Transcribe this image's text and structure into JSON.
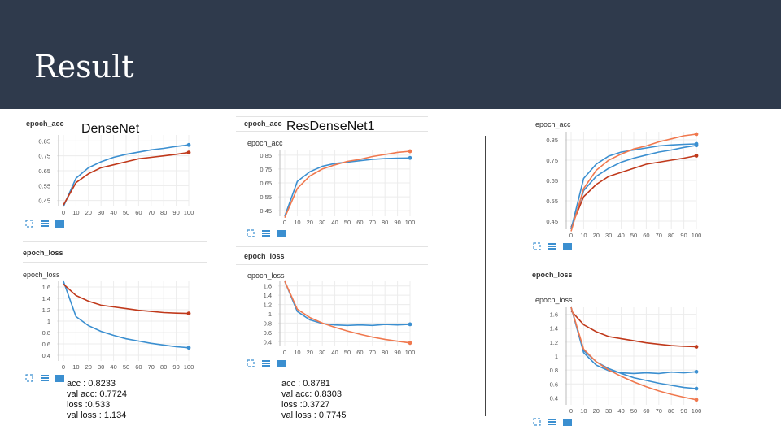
{
  "slide": {
    "title": "Result"
  },
  "colors": {
    "header_bg": "#2f3a4c",
    "train": "#3b8fd0",
    "val": "#c0391b",
    "orange": "#f0784e"
  },
  "panels": [
    {
      "name": "DenseNet",
      "acc_title": "epoch_acc",
      "loss_title": "epoch_loss",
      "stats": [
        "acc : 0.8233",
        "val acc: 0.7724",
        "loss :0.533",
        "val loss : 1.134"
      ]
    },
    {
      "name": "ResDenseNet1",
      "acc_title": "epoch_acc",
      "loss_title": "epoch_loss",
      "stats": [
        "acc : 0.8781",
        "val acc: 0.8303",
        "loss :0.3727",
        "val loss : 0.7745"
      ]
    },
    {
      "name": "",
      "acc_title": "epoch_acc",
      "loss_title": "epoch_loss",
      "stats": []
    }
  ],
  "chart_data": [
    {
      "type": "line",
      "title": "epoch_acc",
      "panel": "DenseNet",
      "x": [
        0,
        10,
        20,
        30,
        40,
        50,
        60,
        70,
        80,
        90,
        100
      ],
      "xticks": [
        "0",
        "10",
        "20",
        "30",
        "40",
        "50",
        "60",
        "70",
        "80",
        "90",
        "100"
      ],
      "yticks": [
        "0.45",
        "0.55",
        "0.65",
        "0.75",
        "0.85"
      ],
      "ylim": [
        0.41,
        0.89
      ],
      "series": [
        {
          "color": "#3b8fd0",
          "values": [
            0.41,
            0.6,
            0.67,
            0.71,
            0.74,
            0.76,
            0.775,
            0.79,
            0.8,
            0.813,
            0.823
          ]
        },
        {
          "color": "#c0391b",
          "values": [
            0.42,
            0.57,
            0.63,
            0.67,
            0.69,
            0.71,
            0.73,
            0.74,
            0.75,
            0.76,
            0.772
          ]
        }
      ]
    },
    {
      "type": "line",
      "title": "epoch_loss",
      "panel": "DenseNet",
      "x": [
        0,
        10,
        20,
        30,
        40,
        50,
        60,
        70,
        80,
        90,
        100
      ],
      "xticks": [
        "0",
        "10",
        "20",
        "30",
        "40",
        "50",
        "60",
        "70",
        "80",
        "90",
        "100"
      ],
      "yticks": [
        "0.4",
        "0.6",
        "0.8",
        "1",
        "1.2",
        "1.4",
        "1.6"
      ],
      "ylim": [
        0.3,
        1.7
      ],
      "series": [
        {
          "color": "#3b8fd0",
          "values": [
            1.7,
            1.08,
            0.92,
            0.82,
            0.75,
            0.69,
            0.65,
            0.61,
            0.58,
            0.55,
            0.533
          ]
        },
        {
          "color": "#c0391b",
          "values": [
            1.65,
            1.45,
            1.35,
            1.28,
            1.25,
            1.22,
            1.19,
            1.17,
            1.15,
            1.14,
            1.134
          ]
        }
      ]
    },
    {
      "type": "line",
      "title": "epoch_acc",
      "panel": "ResDenseNet1",
      "x": [
        0,
        10,
        20,
        30,
        40,
        50,
        60,
        70,
        80,
        90,
        100
      ],
      "xticks": [
        "0",
        "10",
        "20",
        "30",
        "40",
        "50",
        "60",
        "70",
        "80",
        "90",
        "100"
      ],
      "yticks": [
        "0.45",
        "0.55",
        "0.65",
        "0.75",
        "0.85"
      ],
      "ylim": [
        0.41,
        0.89
      ],
      "series": [
        {
          "color": "#3b8fd0",
          "values": [
            0.41,
            0.66,
            0.73,
            0.77,
            0.79,
            0.8,
            0.81,
            0.82,
            0.825,
            0.828,
            0.83
          ]
        },
        {
          "color": "#f0784e",
          "values": [
            0.4,
            0.61,
            0.7,
            0.75,
            0.78,
            0.805,
            0.82,
            0.84,
            0.855,
            0.87,
            0.878
          ]
        }
      ]
    },
    {
      "type": "line",
      "title": "epoch_loss",
      "panel": "ResDenseNet1",
      "x": [
        0,
        10,
        20,
        30,
        40,
        50,
        60,
        70,
        80,
        90,
        100
      ],
      "xticks": [
        "0",
        "10",
        "20",
        "30",
        "40",
        "50",
        "60",
        "70",
        "80",
        "90",
        "100"
      ],
      "yticks": [
        "0.4",
        "0.6",
        "0.8",
        "1",
        "1.2",
        "1.4",
        "1.6"
      ],
      "ylim": [
        0.3,
        1.7
      ],
      "series": [
        {
          "color": "#3b8fd0",
          "values": [
            1.7,
            1.05,
            0.87,
            0.79,
            0.76,
            0.75,
            0.76,
            0.75,
            0.77,
            0.76,
            0.7745
          ]
        },
        {
          "color": "#f0784e",
          "values": [
            1.7,
            1.1,
            0.92,
            0.8,
            0.71,
            0.63,
            0.56,
            0.5,
            0.45,
            0.41,
            0.3727
          ]
        }
      ]
    },
    {
      "type": "line",
      "title": "epoch_acc",
      "panel": "combined",
      "x": [
        0,
        10,
        20,
        30,
        40,
        50,
        60,
        70,
        80,
        90,
        100
      ],
      "xticks": [
        "0",
        "10",
        "20",
        "30",
        "40",
        "50",
        "60",
        "70",
        "80",
        "90",
        "100"
      ],
      "yticks": [
        "0.45",
        "0.55",
        "0.65",
        "0.75",
        "0.85"
      ],
      "ylim": [
        0.41,
        0.89
      ],
      "series": [
        {
          "color": "#3b8fd0",
          "values": [
            0.41,
            0.6,
            0.67,
            0.71,
            0.74,
            0.76,
            0.775,
            0.79,
            0.8,
            0.813,
            0.823
          ]
        },
        {
          "color": "#c0391b",
          "values": [
            0.42,
            0.57,
            0.63,
            0.67,
            0.69,
            0.71,
            0.73,
            0.74,
            0.75,
            0.76,
            0.772
          ]
        },
        {
          "color": "#3b8fd0",
          "values": [
            0.41,
            0.66,
            0.73,
            0.77,
            0.79,
            0.8,
            0.81,
            0.82,
            0.825,
            0.828,
            0.83
          ]
        },
        {
          "color": "#f0784e",
          "values": [
            0.4,
            0.61,
            0.7,
            0.75,
            0.78,
            0.805,
            0.82,
            0.84,
            0.855,
            0.87,
            0.878
          ]
        }
      ]
    },
    {
      "type": "line",
      "title": "epoch_loss",
      "panel": "combined",
      "x": [
        0,
        10,
        20,
        30,
        40,
        50,
        60,
        70,
        80,
        90,
        100
      ],
      "xticks": [
        "0",
        "10",
        "20",
        "30",
        "40",
        "50",
        "60",
        "70",
        "80",
        "90",
        "100"
      ],
      "yticks": [
        "0.4",
        "0.6",
        "0.8",
        "1",
        "1.2",
        "1.4",
        "1.6"
      ],
      "ylim": [
        0.3,
        1.7
      ],
      "series": [
        {
          "color": "#3b8fd0",
          "values": [
            1.7,
            1.08,
            0.92,
            0.82,
            0.75,
            0.69,
            0.65,
            0.61,
            0.58,
            0.55,
            0.533
          ]
        },
        {
          "color": "#c0391b",
          "values": [
            1.65,
            1.45,
            1.35,
            1.28,
            1.25,
            1.22,
            1.19,
            1.17,
            1.15,
            1.14,
            1.134
          ]
        },
        {
          "color": "#3b8fd0",
          "values": [
            1.7,
            1.05,
            0.87,
            0.79,
            0.76,
            0.75,
            0.76,
            0.75,
            0.77,
            0.76,
            0.7745
          ]
        },
        {
          "color": "#f0784e",
          "values": [
            1.7,
            1.1,
            0.92,
            0.8,
            0.71,
            0.63,
            0.56,
            0.5,
            0.45,
            0.41,
            0.3727
          ]
        }
      ]
    }
  ]
}
